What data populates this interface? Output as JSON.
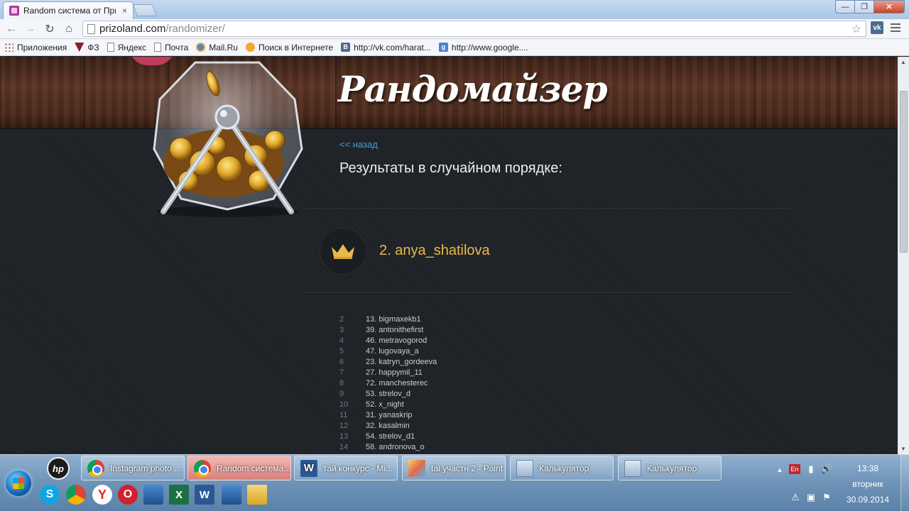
{
  "browser": {
    "tab_title": "Random система от При",
    "tab_close": "×",
    "url_host": "prizoland.com",
    "url_path": "/randomizer/",
    "vk_label": "vk",
    "window_min": "—",
    "window_max": "❐",
    "window_close": "✕",
    "bookmarks": [
      {
        "label": "Приложения",
        "icon": "apps"
      },
      {
        "label": "ФЗ",
        "icon": "fz"
      },
      {
        "label": "Яндекс",
        "icon": "doc"
      },
      {
        "label": "Почта",
        "icon": "doc"
      },
      {
        "label": "Mail.Ru",
        "icon": "mail"
      },
      {
        "label": "Поиск в Интернете",
        "icon": "search"
      },
      {
        "label": "http://vk.com/harat...",
        "icon": "vk"
      },
      {
        "label": "http://www.google....",
        "icon": "goog"
      }
    ]
  },
  "page": {
    "title": "Рандомайзер",
    "back_link": "<< назад",
    "subtitle": "Результаты в случайном порядке:",
    "winner": "2. anya_shatilova",
    "accent_color": "#e9b949",
    "link_color": "#3aa3dd",
    "results": [
      {
        "index": "2",
        "name": "13. bigmaxekb1"
      },
      {
        "index": "3",
        "name": "39. antonithefirst"
      },
      {
        "index": "4",
        "name": "46. metravogorod"
      },
      {
        "index": "5",
        "name": "47. lugovaya_a"
      },
      {
        "index": "6",
        "name": "23. katryn_gordeeva"
      },
      {
        "index": "7",
        "name": "27. happymil_11"
      },
      {
        "index": "8",
        "name": "72. manchesterec"
      },
      {
        "index": "9",
        "name": "53. strelov_d"
      },
      {
        "index": "10",
        "name": "52. x_night"
      },
      {
        "index": "11",
        "name": "31. yanaskrip"
      },
      {
        "index": "12",
        "name": "32. kasalmin"
      },
      {
        "index": "13",
        "name": "54. strelov_d1"
      },
      {
        "index": "14",
        "name": "58. andronova_o"
      }
    ]
  },
  "taskbar": {
    "tasks": [
      {
        "label": "Instagram photo ...",
        "icon": "chrome"
      },
      {
        "label": "Random система...",
        "icon": "chrome"
      },
      {
        "label": "тай конкурс - Mi...",
        "icon": "word"
      },
      {
        "label": "tai участн 2 - Paint",
        "icon": "paint"
      },
      {
        "label": "Калькулятор",
        "icon": "calc"
      },
      {
        "label": "Калькулятор",
        "icon": "calc"
      }
    ],
    "lang": "En",
    "time": "13:38",
    "day": "вторник",
    "date": "30.09.2014",
    "hp_label": "hp"
  }
}
